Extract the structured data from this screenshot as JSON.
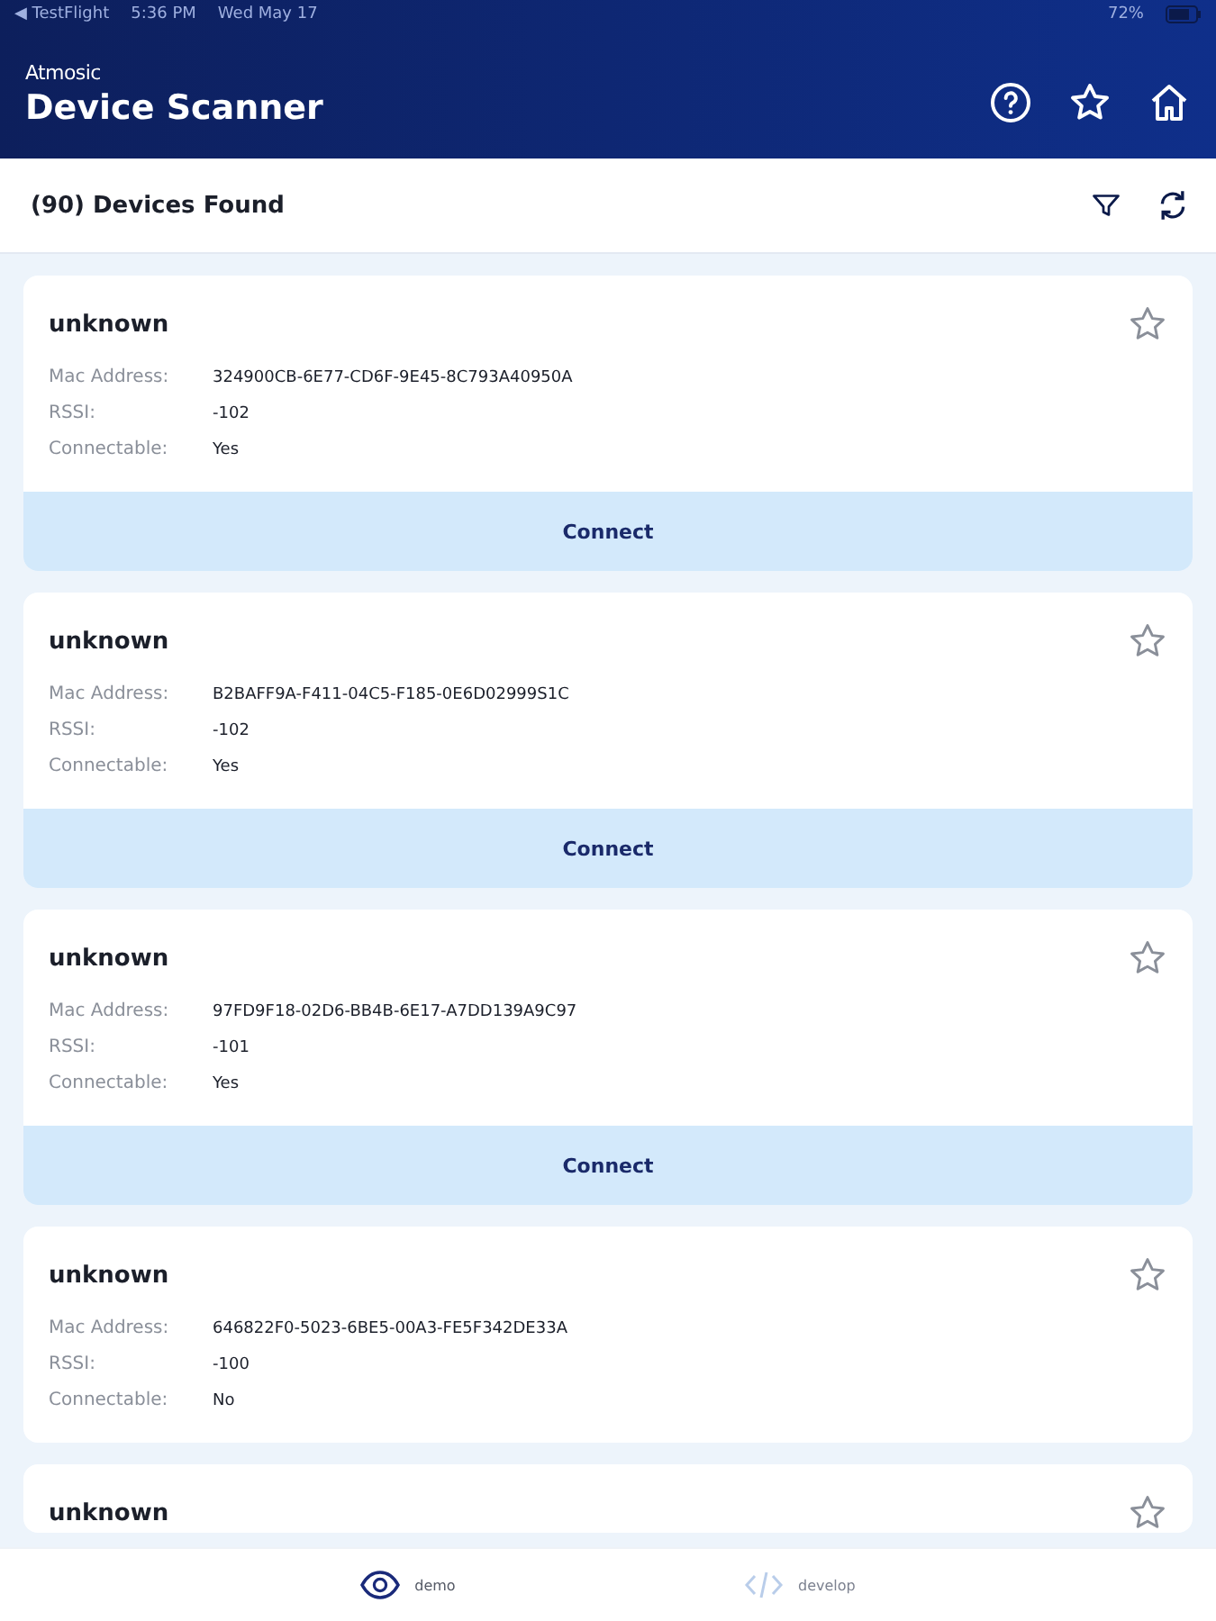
{
  "status_bar": {
    "left": [
      "◀ TestFlight",
      "5:36 PM",
      "Wed May 17"
    ],
    "battery": "72%"
  },
  "header": {
    "brand": "Atmosic",
    "title": "Device Scanner"
  },
  "toolbar": {
    "count": "(90) Devices Found"
  },
  "devices": [
    {
      "name": "unknown",
      "favorite": false,
      "fields": [
        {
          "label": "Mac Address:",
          "value": "324900CB-6E77-CD6F-9E45-8C793A40950A"
        },
        {
          "label": "RSSI:",
          "value": "-102"
        },
        {
          "label": "Connectable:",
          "value": "Yes"
        }
      ],
      "action": "Connect"
    },
    {
      "name": "unknown",
      "favorite": false,
      "fields": [
        {
          "label": "Mac Address:",
          "value": "B2BAFF9A-F411-04C5-F185-0E6D02999S1C"
        },
        {
          "label": "RSSI:",
          "value": "-102"
        },
        {
          "label": "Connectable:",
          "value": "Yes"
        }
      ],
      "action": "Connect"
    },
    {
      "name": "unknown",
      "favorite": false,
      "fields": [
        {
          "label": "Mac Address:",
          "value": "97FD9F18-02D6-BB4B-6E17-A7DD139A9C97"
        },
        {
          "label": "RSSI:",
          "value": "-101"
        },
        {
          "label": "Connectable:",
          "value": "Yes"
        }
      ],
      "action": "Connect"
    },
    {
      "name": "unknown",
      "favorite": false,
      "fields": [
        {
          "label": "Mac Address:",
          "value": "646822F0-5023-6BE5-00A3-FE5F342DE33A"
        },
        {
          "label": "RSSI:",
          "value": "-100"
        },
        {
          "label": "Connectable:",
          "value": "No"
        }
      ]
    },
    {
      "name": "unknown",
      "favorite": false
    }
  ],
  "tabs": [
    {
      "label": "demo",
      "kind": "eye",
      "selected": true
    },
    {
      "label": "develop",
      "kind": "code",
      "selected": false
    }
  ]
}
